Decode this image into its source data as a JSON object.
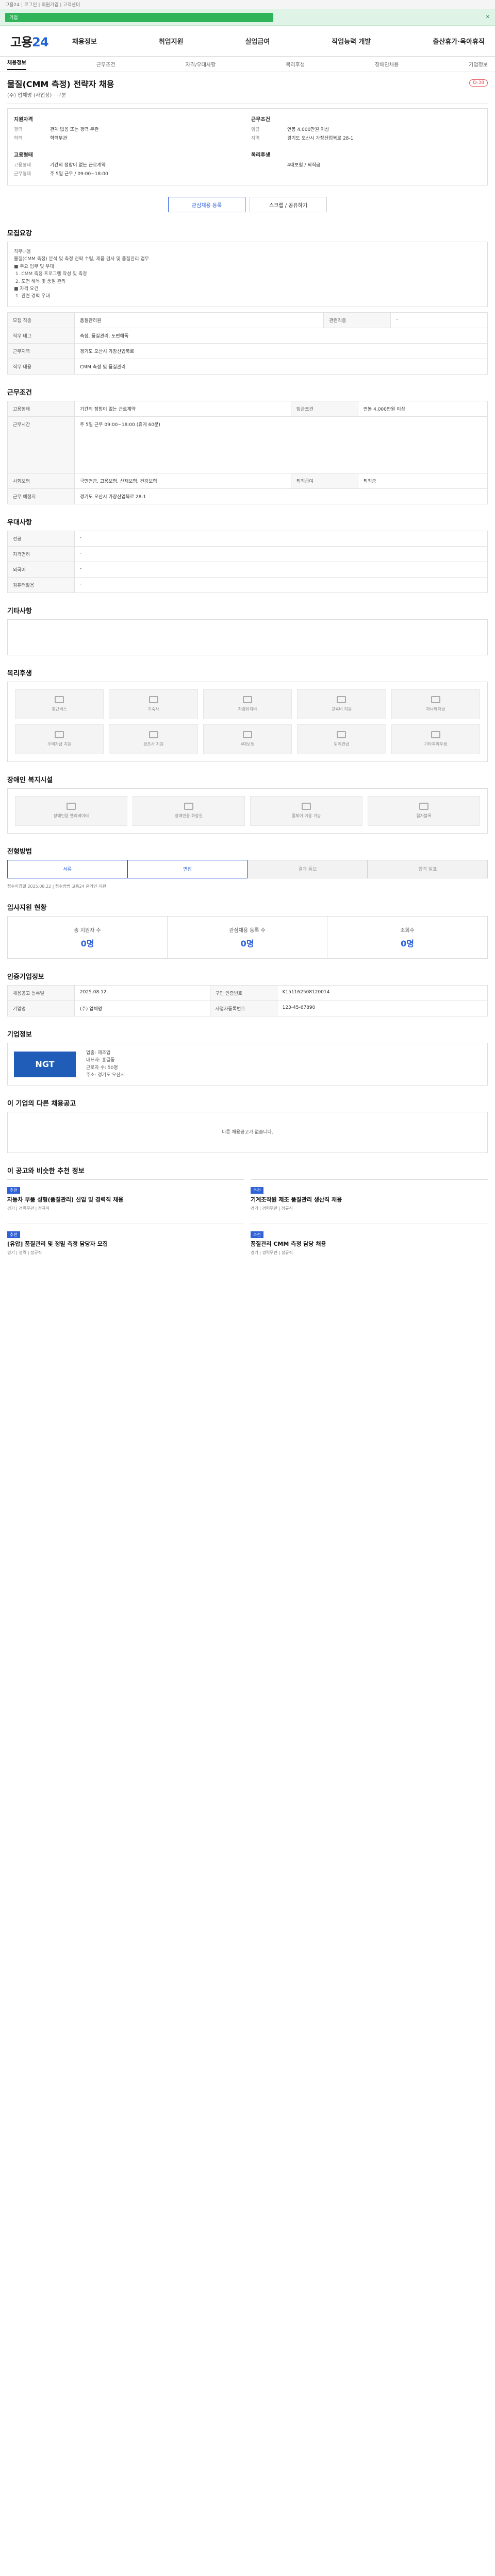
{
  "topbar": {
    "util": "고용24 | 로그인 | 회원가입 | 고객센터"
  },
  "alert": {
    "text": "기업",
    "close": "✕"
  },
  "header": {
    "logo_a": "고용",
    "logo_b": "24",
    "menu": [
      "채용정보",
      "취업지원",
      "실업급여",
      "직업능력 개발",
      "출산휴가·육아휴직"
    ]
  },
  "tabs": [
    "채용정보",
    "근무조건",
    "자격/우대사항",
    "복리후생",
    "장애인채용",
    "기업정보"
  ],
  "job": {
    "title": "물질(CMM 측정) 전략자 채용",
    "company": "(주) 업체명 (사업장) · 구분",
    "dday": "D-38",
    "required": {
      "head": "지원자격",
      "rows": [
        {
          "k": "경력",
          "v": "관계 없음 또는 경력 무관"
        },
        {
          "k": "학력",
          "v": "학력무관"
        }
      ]
    },
    "work": {
      "head": "근무조건",
      "rows": [
        {
          "k": "임금",
          "v": "연봉 4,000만원 이상"
        },
        {
          "k": "지역",
          "v": "경기도 오산시 가장산업북로 28-1"
        }
      ]
    },
    "type": {
      "head": "고용형태",
      "rows": [
        {
          "k": "고용형태",
          "v": "기간의 정함이 없는 근로계약"
        },
        {
          "k": "근무형태",
          "v": "주 5일 근무 / 09:00~18:00"
        }
      ]
    },
    "welfare": {
      "head": "복리후생",
      "rows": [
        {
          "k": "",
          "v": "4대보험 / 퇴직금"
        }
      ]
    }
  },
  "actions": {
    "save": "관심채용 등록",
    "share": "스크랩 / 공유하기"
  },
  "sections": {
    "recruit": "모집요강",
    "condition": "근무조건",
    "prefer": "우대사항",
    "etc": "기타사항",
    "welfare": "복리후생",
    "disabled": "장애인 복지시설",
    "process": "전형방법",
    "stats": "입사지원 현황",
    "meta": "인증기업정보",
    "company": "기업정보",
    "other": "이 기업의 다른 채용공고",
    "recommend": "이 공고와 비슷한 추천 정보"
  },
  "recruit_text": "직무내용\n물질(CMM 측정) 분석 및 측정 전략 수립, 제품 검사 및 품질관리 업무\n■ 주요 업무 및 우대\n 1. CMM 측정 프로그램 작성 및 측정\n 2. 도면 해독 및 품질 관리\n■ 자격 요건\n 1. 관련 경력 우대",
  "recruit_table": [
    [
      "모집 직종",
      "품질관리원",
      "관련직종",
      "-"
    ],
    [
      "직무 태그",
      "측정, 품질관리, 도면해독",
      "",
      ""
    ],
    [
      "근무지역",
      "경기도 오산시 가장산업북로",
      "",
      ""
    ],
    [
      "직무 내용",
      "CMM 측정 및 품질관리",
      "",
      ""
    ]
  ],
  "condition_table": [
    [
      "고용형태",
      "기간의 정함이 없는 근로계약",
      "임금조건",
      "연봉 4,000만원 이상"
    ],
    [
      "근무시간",
      "주 5일 근무 09:00~18:00 (휴게 60분)",
      "",
      ""
    ],
    [
      "사회보험",
      "국민연금, 고용보험, 산재보험, 건강보험",
      "퇴직급여",
      "퇴직금"
    ],
    [
      "근무 예정지",
      "경기도 오산시 가장산업북로 28-1",
      "",
      ""
    ]
  ],
  "prefer_table": [
    [
      "전공",
      "-"
    ],
    [
      "자격면허",
      "-"
    ],
    [
      "외국어",
      "-"
    ],
    [
      "컴퓨터활용",
      "-"
    ]
  ],
  "welfare_items": [
    "통근버스",
    "기숙사",
    "차량유지비",
    "교육비 지원",
    "자녀학자금",
    "주택자금 지원",
    "경조사 지원",
    "4대보험",
    "퇴직연금",
    "기타복리후생"
  ],
  "disabled_items": [
    "장애인용 엘리베이터",
    "장애인용 화장실",
    "휠체어 이용 가능",
    "점자블록"
  ],
  "process_steps": [
    "서류",
    "면접",
    "결과 통보",
    "합격 발표"
  ],
  "process_note": "접수마감일 2025.08.22 | 접수방법 고용24 온라인 지원",
  "stats": [
    {
      "c": "총 지원자 수",
      "n": "0명"
    },
    {
      "c": "관심채용 등록 수",
      "n": "0명"
    },
    {
      "c": "조회수",
      "n": "0명"
    }
  ],
  "meta_table": [
    [
      "채용공고 등록일",
      "2025.08.12",
      "구인 인증번호",
      "K151162508120014"
    ],
    [
      "기업명",
      "(주) 업체명",
      "사업자등록번호",
      "123-45-67890"
    ]
  ],
  "company_info": {
    "name": "NGT",
    "rows": [
      "업종: 제조업",
      "대표자: 홍길동",
      "근로자 수: 50명",
      "주소: 경기도 오산시"
    ]
  },
  "other_empty": "다른 채용공고가 없습니다.",
  "recommend_cards": [
    {
      "badge": "추천",
      "title": "자동차 부품 성형(품질관리) 신입 및 경력직 채용",
      "meta": "경기 | 경력무관 | 정규직"
    },
    {
      "badge": "추천",
      "title": "기계조작원 제조 품질관리 생산직 채용",
      "meta": "경기 | 경력무관 | 정규직"
    },
    {
      "badge": "추천",
      "title": "[유압] 품질관리 및 정밀 측정 담당자 모집",
      "meta": "경기 | 경력 | 정규직"
    },
    {
      "badge": "추천",
      "title": "품질관리 CMM 측정 담당 채용",
      "meta": "경기 | 경력무관 | 정규직"
    }
  ]
}
